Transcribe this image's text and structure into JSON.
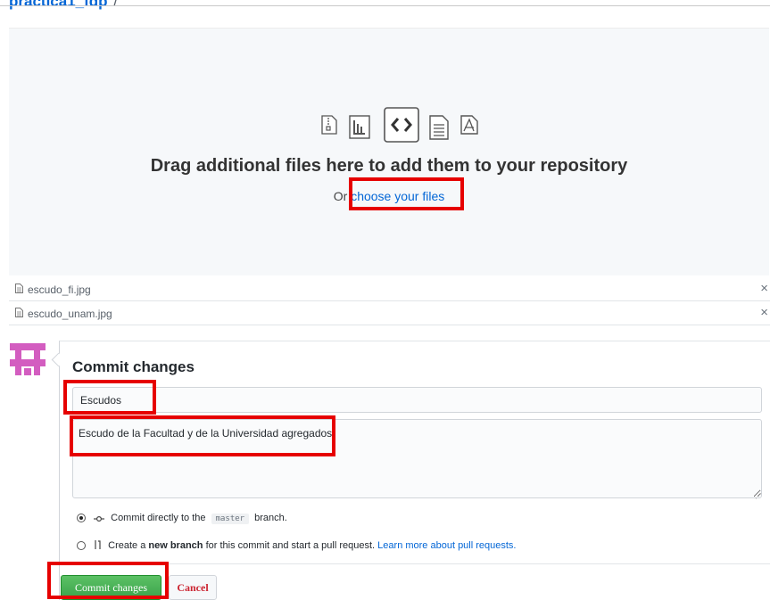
{
  "breadcrumb": {
    "repo": "practica1_fdp",
    "separator": "/"
  },
  "dropzone": {
    "title": "Drag additional files here to add them to your repository",
    "prefix": "Or ",
    "link": "choose your files",
    "icons": [
      "zip-file-icon",
      "chart-file-icon",
      "code-file-icon",
      "text-file-icon",
      "pdf-file-icon"
    ]
  },
  "files": [
    {
      "name": "escudo_fi.jpg",
      "remove": "×"
    },
    {
      "name": "escudo_unam.jpg",
      "remove": "×"
    }
  ],
  "commit": {
    "title": "Commit changes",
    "summary": "Escudos",
    "description": "Escudo de la Facultad y de la Universidad agregados",
    "option1": {
      "before": "Commit directly to the",
      "branch": "master",
      "after": "branch.",
      "selected": true
    },
    "option2": {
      "before": "Create a",
      "bold": "new branch",
      "middle": "for this commit and start a pull request.",
      "link": "Learn more about pull requests.",
      "selected": false
    },
    "submit": "Commit changes",
    "cancel": "Cancel"
  },
  "colors": {
    "link": "#0366d6",
    "highlight": "#e60000",
    "commit_button": "#3aa34a",
    "cancel_text": "#cb2431",
    "avatar": "#d35dc0"
  }
}
